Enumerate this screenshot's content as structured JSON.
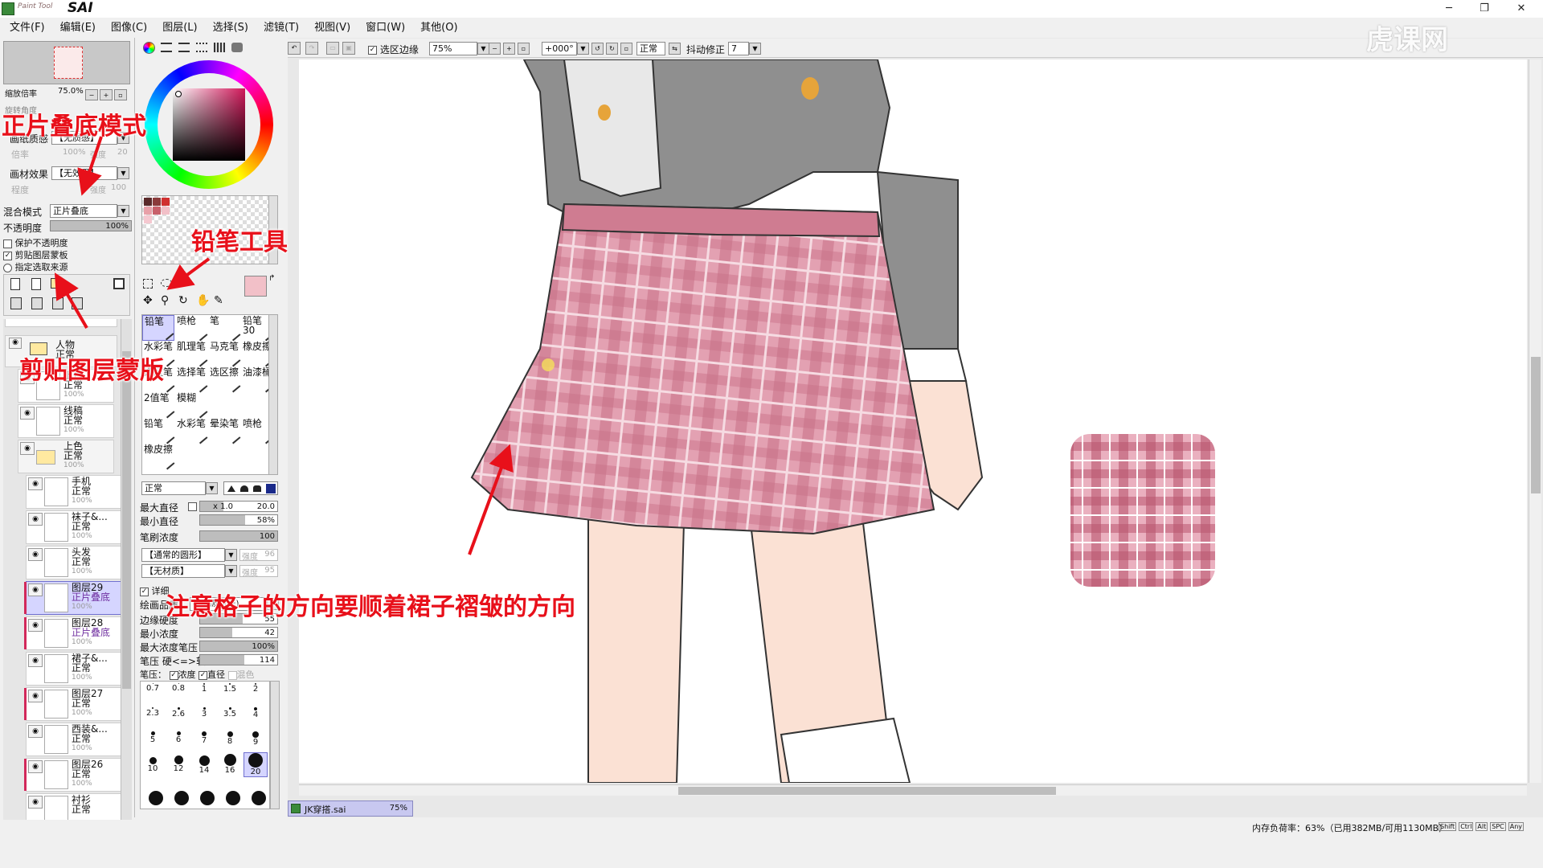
{
  "app": {
    "brand_small": "Paint Tool",
    "brand": "SAI",
    "close_icon": "close-icon"
  },
  "menu": [
    "文件(F)",
    "编辑(E)",
    "图像(C)",
    "图层(L)",
    "选择(S)",
    "滤镜(T)",
    "视图(V)",
    "窗口(W)",
    "其他(O)"
  ],
  "navigator": {
    "zoom_label": "缩放倍率",
    "zoom_value": "75.0%",
    "angle_label": "旋转角度",
    "angle_value": "+000"
  },
  "paper": {
    "texture_label": "画纸质感",
    "texture_value": "【无质感】",
    "scale_label": "倍率",
    "scale_value": "100%",
    "strength_label": "强度",
    "strength_value": "20",
    "effect_label": "画材效果",
    "effect_value": "【无效果】",
    "degree_label": "程度",
    "intensity_label": "强度",
    "intensity_value": "100"
  },
  "layer_props": {
    "blend_label": "混合模式",
    "blend_value": "正片叠底",
    "opacity_label": "不透明度",
    "opacity_value": "100%",
    "protect_label": "保护不透明度",
    "clip_label": "剪贴图层蒙板",
    "source_label": "指定选取来源"
  },
  "layers": [
    {
      "name": "人物",
      "mode": "正常",
      "folder": true
    },
    {
      "name": "上色",
      "mode": "正常",
      "opacity": "100%"
    },
    {
      "name": "线稿",
      "mode": "正常",
      "opacity": "100%"
    },
    {
      "name": "上色",
      "mode": "正常",
      "opacity": "100%",
      "folder": true
    },
    {
      "name": "手机",
      "mode": "正常",
      "opacity": "100%"
    },
    {
      "name": "袜子&...",
      "mode": "正常",
      "opacity": "100%"
    },
    {
      "name": "头发",
      "mode": "正常",
      "opacity": "100%"
    },
    {
      "name": "图层29",
      "mode": "正片叠底",
      "opacity": "100%",
      "selected": true
    },
    {
      "name": "图层28",
      "mode": "正片叠底",
      "opacity": "100%"
    },
    {
      "name": "裙子&...",
      "mode": "正常",
      "opacity": "100%"
    },
    {
      "name": "图层27",
      "mode": "正常",
      "opacity": "100%"
    },
    {
      "name": "西装&...",
      "mode": "正常",
      "opacity": "100%"
    },
    {
      "name": "图层26",
      "mode": "正常",
      "opacity": "100%"
    },
    {
      "name": "衬衫",
      "mode": "正常"
    }
  ],
  "tools": [
    {
      "name": "铅笔",
      "selected": true
    },
    {
      "name": "喷枪"
    },
    {
      "name": "笔"
    },
    {
      "name": "铅笔30"
    },
    {
      "name": "水彩笔"
    },
    {
      "name": "肌理笔"
    },
    {
      "name": "马克笔"
    },
    {
      "name": "橡皮擦"
    },
    {
      "name": "选区笔"
    },
    {
      "name": "选择笔"
    },
    {
      "name": "选区擦"
    },
    {
      "name": "油漆桶"
    },
    {
      "name": "2值笔"
    },
    {
      "name": "模糊"
    },
    {
      "name": "铅笔"
    },
    {
      "name": "水彩笔"
    },
    {
      "name": "晕染笔"
    },
    {
      "name": "喷枪"
    },
    {
      "name": "橡皮擦"
    }
  ],
  "brush": {
    "mode": "正常",
    "max_size_label": "最大直径",
    "max_size_mult": "x 1.0",
    "max_size_value": "20.0",
    "min_size_label": "最小直径",
    "min_size_value": "58%",
    "density_label": "笔刷浓度",
    "density_value": "100",
    "shape_value": "【通常的圆形】",
    "shape_strength_label": "强度",
    "shape_strength_value": "96",
    "texture_value": "【无材质】",
    "texture_strength_label": "强度",
    "texture_strength_value": "95",
    "detail_label": "详细",
    "quality_label": "绘画品质",
    "quality_value": "4 (品质优先)",
    "edge_label": "边缘硬度",
    "edge_value": "55",
    "min_density_label": "最小浓度",
    "min_density_value": "42",
    "max_pressure_label": "最大浓度笔压",
    "max_pressure_value": "100%",
    "pressure_label": "笔压  硬<=>软",
    "pressure_value": "114",
    "pressure_opts_label": "笔压：",
    "pressure_density": "浓度",
    "pressure_size": "直径",
    "pressure_blend": "混色",
    "sizes": [
      "0.7",
      "0.8",
      "1",
      "1.5",
      "2",
      "2.3",
      "2.6",
      "3",
      "3.5",
      "4",
      "5",
      "6",
      "7",
      "8",
      "9",
      "10",
      "12",
      "14",
      "16",
      "20"
    ]
  },
  "canvas_toolbar": {
    "selection_edge_label": "选区边缘",
    "zoom_value": "75%",
    "angle_value": "+000°",
    "blend_value": "正常",
    "stabilizer_label": "抖动修正",
    "stabilizer_value": "7"
  },
  "doc_tab": {
    "name": "JK穿搭.sai",
    "zoom": "75%"
  },
  "status": {
    "memory": "内存负荷率：63%（已用382MB/可用1130MB）",
    "keys": [
      "Shift",
      "Ctrl",
      "Alt",
      "SPC",
      "Any"
    ]
  },
  "annotations": {
    "multiply": "正片叠底模式",
    "pencil": "铅笔工具",
    "clipmask": "剪贴图层蒙版",
    "note": "注意格子的方向要顺着裙子褶皱的方向"
  },
  "watermark": "虎课网",
  "colors": {
    "accent": "#e8101a",
    "skirt": "#d98aa0",
    "blazer": "#8e8e8e",
    "selection": "#d5d5ff",
    "clip": "#d2285a"
  }
}
